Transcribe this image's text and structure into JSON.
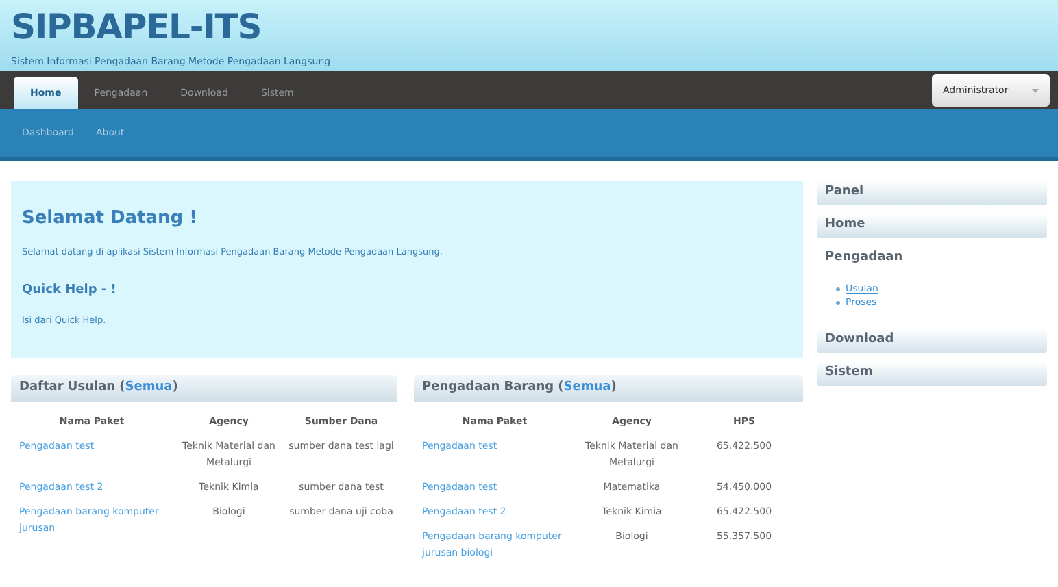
{
  "header": {
    "title": "SIPBAPEL-ITS",
    "subtitle": "Sistem Informasi Pengadaan Barang Metode Pengadaan Langsung"
  },
  "nav": [
    {
      "label": "Home",
      "selected": true
    },
    {
      "label": "Pengadaan",
      "selected": false
    },
    {
      "label": "Download",
      "selected": false
    },
    {
      "label": "Sistem",
      "selected": false
    }
  ],
  "user_menu": {
    "label": "Administrator"
  },
  "subnav": [
    "Dashboard",
    "About"
  ],
  "welcome": {
    "title": "Selamat Datang !",
    "text": "Selamat datang di aplikasi Sistem Informasi Pengadaan Barang Metode Pengadaan Langsung.",
    "help_title": "Quick Help - !",
    "help_text": "Isi dari Quick Help."
  },
  "tables": [
    {
      "title": "Daftar Usulan (",
      "link": "Semua",
      "title_end": ")",
      "columns": [
        "Nama Paket",
        "Agency",
        "Sumber Dana"
      ],
      "rows": [
        [
          "Pengadaan test",
          "Teknik Material dan Metalurgi",
          "sumber dana test lagi"
        ],
        [
          "Pengadaan test 2",
          "Teknik Kimia",
          "sumber dana test"
        ],
        [
          "Pengadaan barang komputer jurusan",
          "Biologi",
          "sumber dana uji coba"
        ]
      ]
    },
    {
      "title": "Pengadaan Barang (",
      "link": "Semua",
      "title_end": ")",
      "columns": [
        "Nama Paket",
        "Agency",
        "HPS"
      ],
      "rows": [
        [
          "Pengadaan test",
          "Teknik Material dan Metalurgi",
          "65.422.500"
        ],
        [
          "Pengadaan test",
          "Matematika",
          "54.450.000"
        ],
        [
          "Pengadaan test 2",
          "Teknik Kimia",
          "65.422.500"
        ],
        [
          "Pengadaan barang komputer jurusan biologi",
          "Biologi",
          "55.357.500"
        ]
      ]
    }
  ],
  "sidebar": [
    {
      "label": "Panel",
      "kind": "header"
    },
    {
      "label": "Home",
      "kind": "header"
    },
    {
      "label": "Pengadaan",
      "kind": "section",
      "children": [
        "Usulan",
        "Proses"
      ]
    },
    {
      "label": "Download",
      "kind": "header"
    },
    {
      "label": "Sistem",
      "kind": "header"
    }
  ]
}
